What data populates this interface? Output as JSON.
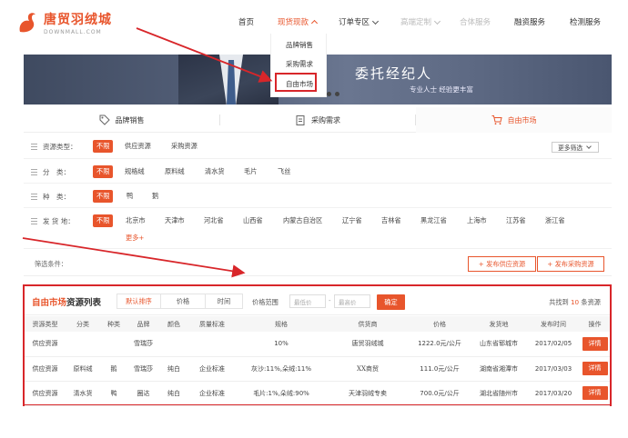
{
  "header": {
    "logo_cn": "唐贸羽绒城",
    "logo_en": "DOWNMALL.COM",
    "nav": [
      {
        "label": "首页",
        "state": "normal"
      },
      {
        "label": "现货现款",
        "state": "active"
      },
      {
        "label": "订单专区",
        "state": "normal"
      },
      {
        "label": "高端定制",
        "state": "muted"
      },
      {
        "label": "合体服务",
        "state": "muted"
      },
      {
        "label": "融资服务",
        "state": "normal"
      },
      {
        "label": "检测服务",
        "state": "normal"
      }
    ],
    "dropdown": [
      "品牌销售",
      "采购需求",
      "自由市场"
    ]
  },
  "banner": {
    "title": "委托经纪人",
    "subtitle": "专业人士 经验更丰富"
  },
  "category_tabs": [
    {
      "label": "品牌销售",
      "icon": "tag-icon"
    },
    {
      "label": "采购需求",
      "icon": "clipboard-icon"
    },
    {
      "label": "自由市场",
      "icon": "cart-icon"
    }
  ],
  "filters": {
    "type": {
      "label": "资源类型：",
      "options": [
        "不限",
        "供应资源",
        "采购资源"
      ]
    },
    "category": {
      "label": "分　类：",
      "options": [
        "不限",
        "规格绒",
        "原料绒",
        "清水货",
        "毛片",
        "飞丝"
      ]
    },
    "species": {
      "label": "种　类：",
      "options": [
        "不限",
        "鸭",
        "鹅"
      ]
    },
    "origin": {
      "label": "发 货 地：",
      "options": [
        "不限",
        "北京市",
        "天津市",
        "河北省",
        "山西省",
        "内蒙古自治区",
        "辽宁省",
        "吉林省",
        "黑龙江省",
        "上海市",
        "江苏省",
        "浙江省"
      ],
      "more": "更多+"
    },
    "more_filter": "更多筛选",
    "conditions_label": "筛选条件：",
    "publish_supply": "+ 发布供应资源",
    "publish_purchase": "+ 发布采购资源"
  },
  "resource_list": {
    "title_hl": "自由市场",
    "title_rest": "资源列表",
    "sort_tabs": [
      "默认排序",
      "价格",
      "时间"
    ],
    "price_range_label": "价格范围",
    "min_placeholder": "最低价",
    "max_placeholder": "最高价",
    "dash": "-",
    "ok": "确定",
    "found_prefix": "共找到 ",
    "found_count": "10",
    "found_suffix": " 条资源",
    "columns": [
      "资源类型",
      "分类",
      "种类",
      "品牌",
      "颜色",
      "质量标准",
      "规格",
      "供货商",
      "价格",
      "发货地",
      "发布时间",
      "操作"
    ],
    "rows": [
      [
        "供应资源",
        "",
        "",
        "雪瑞莎",
        "",
        "",
        "10%",
        "唐贸羽绒城",
        "1222.0元/公斤",
        "山东省郓城市",
        "2017/02/05",
        "详情"
      ],
      [
        "供应资源",
        "原料绒",
        "鹅",
        "雪瑞莎",
        "纯白",
        "企业标准",
        "灰沙:11%,朵绒:11%",
        "XX商贸",
        "111.0元/公斤",
        "湖南省湘潭市",
        "2017/03/03",
        "详情"
      ],
      [
        "供应资源",
        "清水货",
        "鸭",
        "圈达",
        "纯白",
        "企业标准",
        "毛片:1%,朵绒:90%",
        "天津羽绒专卖",
        "700.0元/公斤",
        "湖北省随州市",
        "2017/03/20",
        "详情"
      ]
    ]
  },
  "colors": {
    "accent": "#e8552c",
    "annotation": "#d8262a"
  }
}
